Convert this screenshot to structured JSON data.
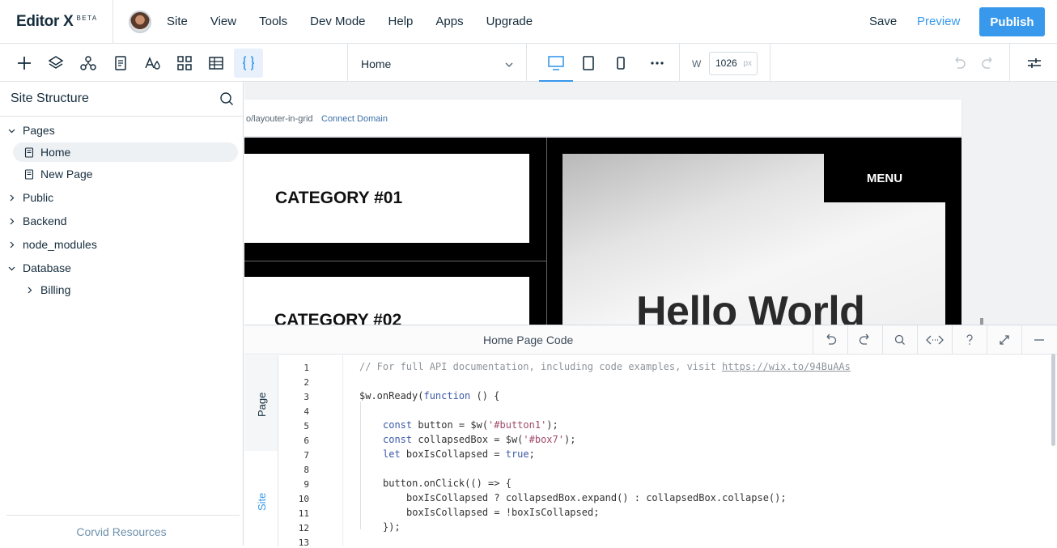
{
  "app": {
    "logo": "Editor X",
    "logo_badge": "BETA"
  },
  "menu": [
    "Site",
    "View",
    "Tools",
    "Dev Mode",
    "Help",
    "Apps",
    "Upgrade"
  ],
  "actions": {
    "save": "Save",
    "preview": "Preview",
    "publish": "Publish"
  },
  "toolbar": {
    "tools": [
      "add-icon",
      "layers-icon",
      "connections-icon",
      "pages-icon",
      "theme-icon",
      "apps-grid-icon",
      "table-icon",
      "code-icon"
    ],
    "page_select": "Home",
    "devices": [
      "desktop-icon",
      "tablet-icon",
      "mobile-icon",
      "more-icon"
    ],
    "width_label": "W",
    "width_value": "1026",
    "width_unit": "px"
  },
  "sidebar": {
    "title": "Site Structure",
    "tree": {
      "pages": "Pages",
      "home": "Home",
      "new_page": "New Page",
      "public": "Public",
      "backend": "Backend",
      "node_modules": "node_modules",
      "database": "Database",
      "billing": "Billing"
    },
    "footer": "Corvid Resources"
  },
  "canvas": {
    "url": "o/layouter-in-grid",
    "connect": "Connect Domain",
    "cat1": "CATEGORY #01",
    "cat2": "CATEGORY #02",
    "menu": "MENU",
    "hero": "Hello World"
  },
  "code_panel": {
    "title": "Home Page Code",
    "tabs": {
      "page": "Page",
      "site": "Site"
    },
    "line_numbers": [
      "1",
      "2",
      "3",
      "4",
      "5",
      "6",
      "7",
      "8",
      "9",
      "10",
      "11",
      "12",
      "13"
    ],
    "lines": {
      "l1_comment": "// For full API documentation, including code examples, visit ",
      "l1_link": "https://wix.to/94BuAAs",
      "l3a": "$w.onReady(",
      "l3kw": "function",
      "l3b": " () {",
      "l5kw": "const",
      "l5a": " button = $w(",
      "l5s": "'#button1'",
      "l5b": ");",
      "l6kw": "const",
      "l6a": " collapsedBox = $w(",
      "l6s": "'#box7'",
      "l6b": ");",
      "l7kw": "let",
      "l7a": " boxIsCollapsed = ",
      "l7v": "true",
      "l7b": ";",
      "l9": "button.onClick(() => {",
      "l10": "boxIsCollapsed ? collapsedBox.expand() : collapsedBox.collapse();",
      "l11": "boxIsCollapsed = !boxIsCollapsed;",
      "l12": "});"
    }
  }
}
